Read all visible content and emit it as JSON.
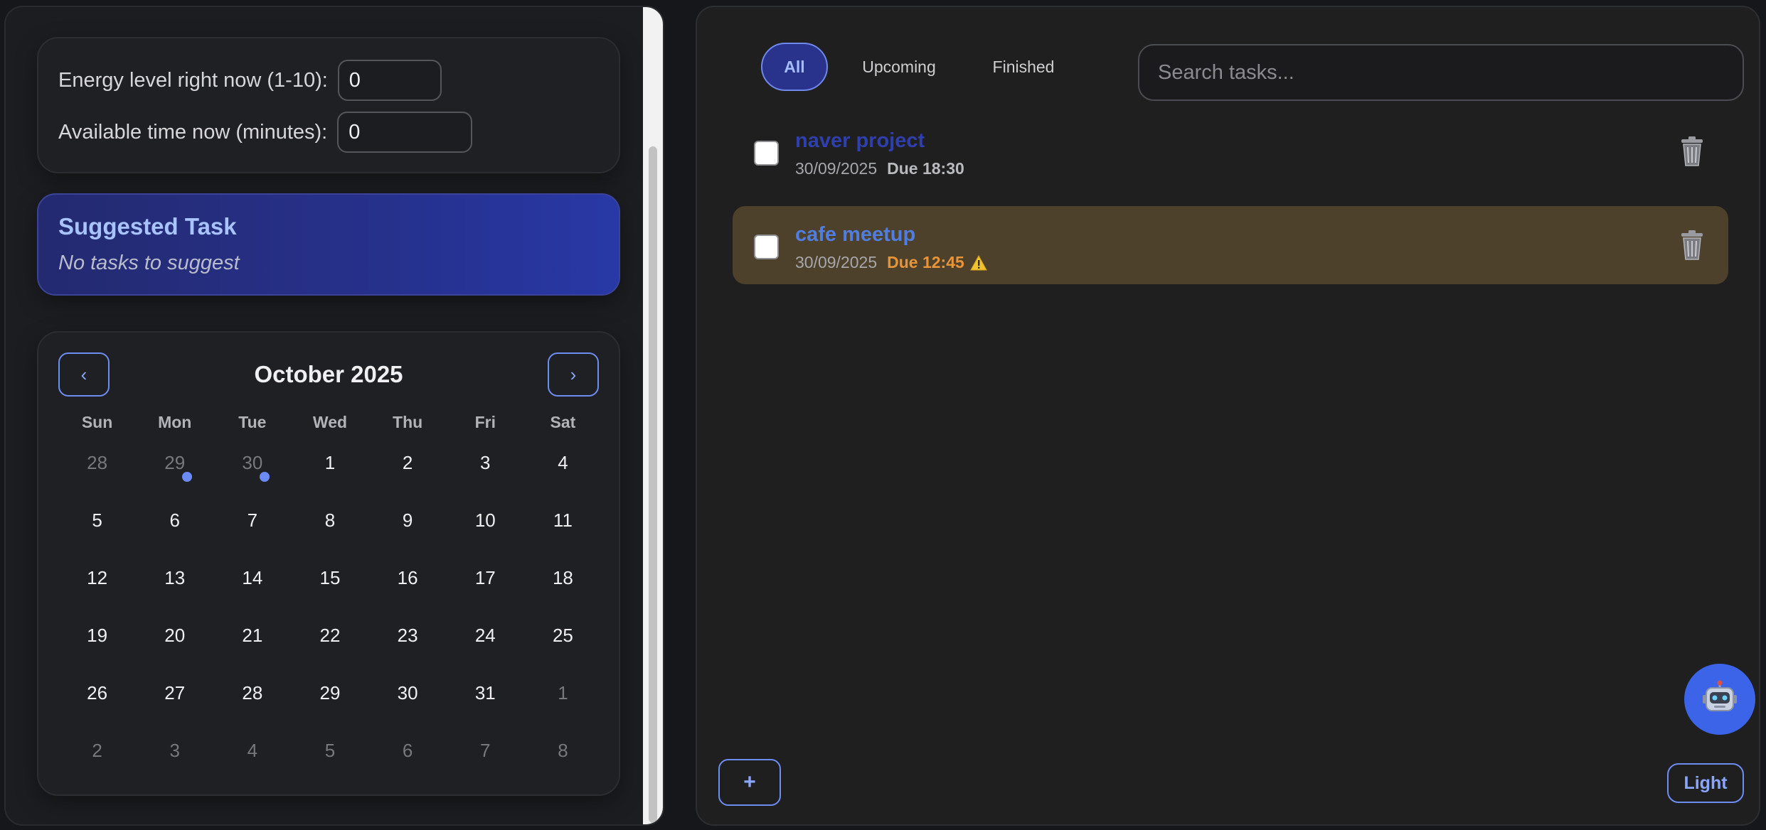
{
  "inputs": {
    "energy_label": "Energy level right now (1-10):",
    "energy_value": "0",
    "time_label": "Available time now (minutes):",
    "time_value": "0"
  },
  "suggestion": {
    "title": "Suggested Task",
    "subtitle": "No tasks to suggest"
  },
  "calendar": {
    "prev_label": "‹",
    "next_label": "›",
    "month_title": "October 2025",
    "weekdays": [
      "Sun",
      "Mon",
      "Tue",
      "Wed",
      "Thu",
      "Fri",
      "Sat"
    ],
    "weeks": [
      [
        {
          "d": "28",
          "muted": true
        },
        {
          "d": "29",
          "muted": true,
          "dot": true
        },
        {
          "d": "30",
          "muted": true,
          "dot": true
        },
        {
          "d": "1"
        },
        {
          "d": "2"
        },
        {
          "d": "3"
        },
        {
          "d": "4"
        }
      ],
      [
        {
          "d": "5"
        },
        {
          "d": "6"
        },
        {
          "d": "7"
        },
        {
          "d": "8"
        },
        {
          "d": "9"
        },
        {
          "d": "10"
        },
        {
          "d": "11"
        }
      ],
      [
        {
          "d": "12"
        },
        {
          "d": "13"
        },
        {
          "d": "14"
        },
        {
          "d": "15"
        },
        {
          "d": "16"
        },
        {
          "d": "17"
        },
        {
          "d": "18"
        }
      ],
      [
        {
          "d": "19"
        },
        {
          "d": "20"
        },
        {
          "d": "21"
        },
        {
          "d": "22"
        },
        {
          "d": "23"
        },
        {
          "d": "24"
        },
        {
          "d": "25"
        }
      ],
      [
        {
          "d": "26"
        },
        {
          "d": "27"
        },
        {
          "d": "28"
        },
        {
          "d": "29"
        },
        {
          "d": "30"
        },
        {
          "d": "31"
        },
        {
          "d": "1",
          "muted": true
        }
      ],
      [
        {
          "d": "2",
          "muted": true
        },
        {
          "d": "3",
          "muted": true
        },
        {
          "d": "4",
          "muted": true
        },
        {
          "d": "5",
          "muted": true
        },
        {
          "d": "6",
          "muted": true
        },
        {
          "d": "7",
          "muted": true
        },
        {
          "d": "8",
          "muted": true
        }
      ]
    ]
  },
  "filters": {
    "all": "All",
    "upcoming": "Upcoming",
    "finished": "Finished",
    "active": "all"
  },
  "search": {
    "placeholder": "Search tasks..."
  },
  "tasks": [
    {
      "title": "naver project",
      "date": "30/09/2025",
      "due": "Due 18:30",
      "overdue": false
    },
    {
      "title": "cafe meetup",
      "date": "30/09/2025",
      "due": "Due 12:45",
      "overdue": true
    }
  ],
  "actions": {
    "add_label": "+",
    "theme_label": "Light"
  },
  "colors": {
    "accent": "#6d8df0",
    "overdue_bg": "#4e412b",
    "overdue_due": "#e8953a",
    "robot_bg": "#3b64e8"
  }
}
